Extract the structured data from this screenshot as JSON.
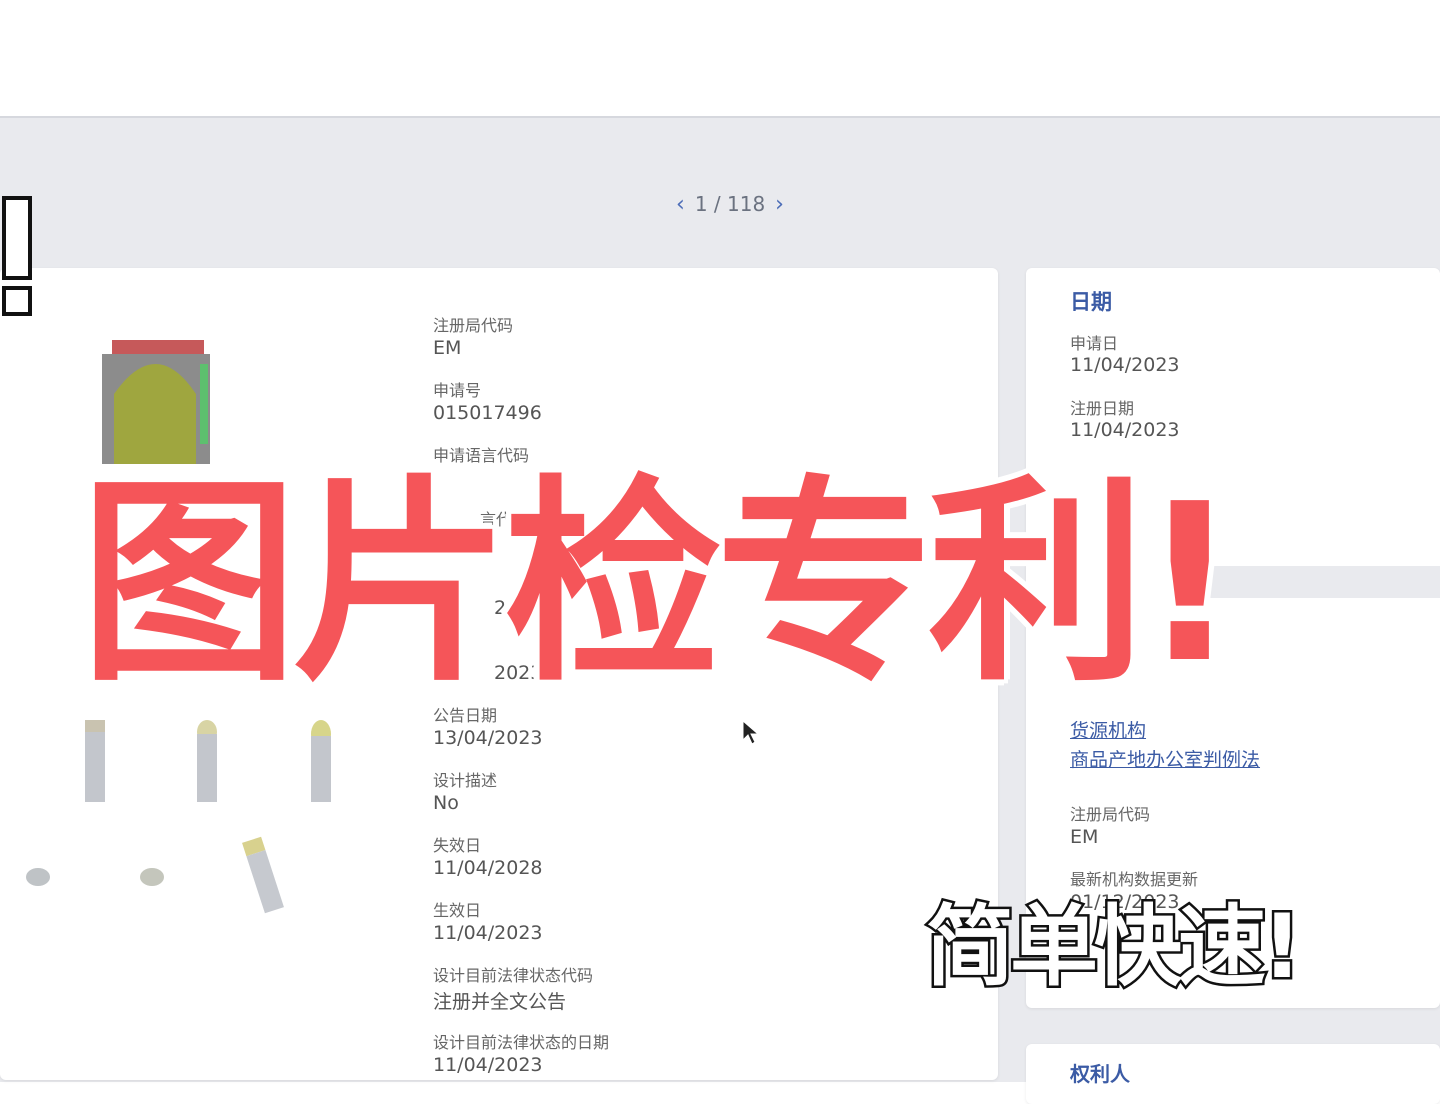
{
  "pager": {
    "prev_icon": "chevron-left-icon",
    "text": "1 / 118",
    "next_icon": "chevron-right-icon"
  },
  "main_fields": [
    {
      "label": "注册局代码",
      "value": "EM"
    },
    {
      "label": "申请号",
      "value": "015017496"
    },
    {
      "label": "申请语言代码",
      "value": ""
    },
    {
      "label": "言代码",
      "value": ""
    },
    {
      "label": "",
      "value": "20"
    },
    {
      "label": "",
      "value": "2023"
    },
    {
      "label": "公告日期",
      "value": "13/04/2023"
    },
    {
      "label": "设计描述",
      "value": "No"
    },
    {
      "label": "失效日",
      "value": "11/04/2028"
    },
    {
      "label": "生效日",
      "value": "11/04/2023"
    },
    {
      "label": "设计目前法律状态代码",
      "value": "注册并全文公告"
    },
    {
      "label": "设计目前法律状态的日期",
      "value": "11/04/2023"
    }
  ],
  "dates_card": {
    "title": "日期",
    "fields": [
      {
        "label": "申请日",
        "value": "11/04/2023"
      },
      {
        "label": "注册日期",
        "value": "11/04/2023"
      }
    ]
  },
  "source_card": {
    "links": [
      "货源机构",
      "商品产地办公室判例法"
    ],
    "fields": [
      {
        "label": "注册局代码",
        "value": "EM"
      },
      {
        "label": "最新机构数据更新",
        "value": "01/12/2023"
      }
    ]
  },
  "holder_card": {
    "title": "权利人"
  },
  "overlay": {
    "title": "图片检专利!",
    "subtitle": "简单快速!"
  },
  "colors": {
    "accent": "#3b5ba5",
    "overlay_red": "#f55559"
  }
}
